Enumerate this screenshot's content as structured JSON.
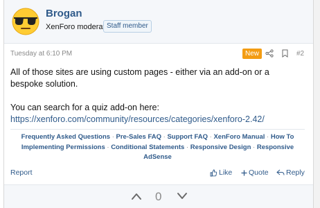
{
  "post": {
    "username": "Brogan",
    "user_title": "XenForo moderator",
    "staff_badge": "Staff member",
    "date": "Tuesday at 6:10 PM",
    "new_badge": "New",
    "post_number": "#2",
    "body": {
      "line1": "All of those sites are using custom pages - either via an add-on or a bespoke solution.",
      "line2": "You can search for a quiz add-on here:",
      "link": "https://xenforo.com/community/resources/categories/xenforo-2.42/"
    },
    "signature_links": [
      "Frequently Asked Questions",
      "Pre-Sales FAQ",
      "Support FAQ",
      "XenForo Manual",
      "How To",
      "Implementing Permissions",
      "Conditional Statements",
      "Responsive Design",
      "Responsive AdSense"
    ],
    "signature_separator": "·",
    "actions": {
      "report": "Report",
      "like": "Like",
      "quote": "Quote",
      "reply": "Reply"
    },
    "vote_count": "0"
  },
  "colors": {
    "link": "#2f5a8a",
    "new_badge": "#f39c12",
    "muted": "#8a8a8a"
  },
  "icons": {
    "avatar": "sunglasses-emoji-avatar",
    "share": "share-icon",
    "bookmark": "bookmark-icon",
    "like": "thumbs-up-icon",
    "quote": "plus-icon",
    "reply": "reply-arrow-icon",
    "vote_up": "chevron-up-icon",
    "vote_down": "chevron-down-icon"
  }
}
